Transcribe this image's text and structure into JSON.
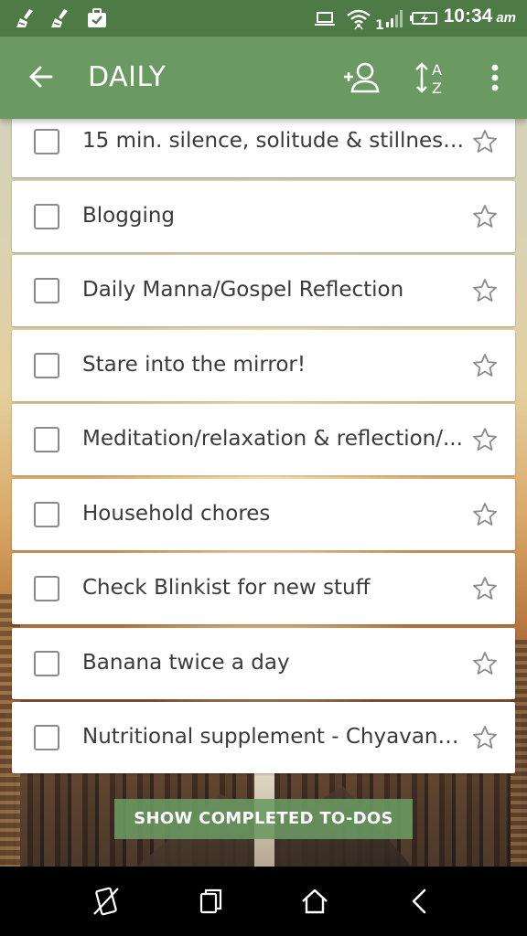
{
  "status_bar": {
    "icons": [
      "broom-icon",
      "broom-icon",
      "briefcase-check-icon",
      "laptop-icon",
      "wifi-icon",
      "signal-icon",
      "battery-icon"
    ],
    "signal_label": "1",
    "time": "10:34",
    "ampm": "am"
  },
  "app_bar": {
    "title": "DAILY",
    "back_icon": "arrow-back-icon",
    "actions": [
      "add-person-icon",
      "sort-az-icon",
      "more-vert-icon"
    ],
    "color": "#6a9a62"
  },
  "tasks": [
    {
      "label": "15 min. silence, solitude & stillness...",
      "checked": false,
      "starred": false
    },
    {
      "label": "Blogging",
      "checked": false,
      "starred": false
    },
    {
      "label": "Daily Manna/Gospel Reflection",
      "checked": false,
      "starred": false
    },
    {
      "label": "Stare into the mirror!",
      "checked": false,
      "starred": false
    },
    {
      "label": "Meditation/relaxation & reflection/...",
      "checked": false,
      "starred": false
    },
    {
      "label": "Household chores",
      "checked": false,
      "starred": false
    },
    {
      "label": "Check Blinkist for new stuff",
      "checked": false,
      "starred": false
    },
    {
      "label": "Banana twice a day",
      "checked": false,
      "starred": false
    },
    {
      "label": "Nutritional supplement - Chyavanp...",
      "checked": false,
      "starred": false
    }
  ],
  "show_completed": {
    "label": "SHOW COMPLETED TO-DOS"
  },
  "nav_bar": {
    "icons": [
      "screenshot-off-icon",
      "recent-apps-icon",
      "home-icon",
      "back-icon"
    ]
  }
}
